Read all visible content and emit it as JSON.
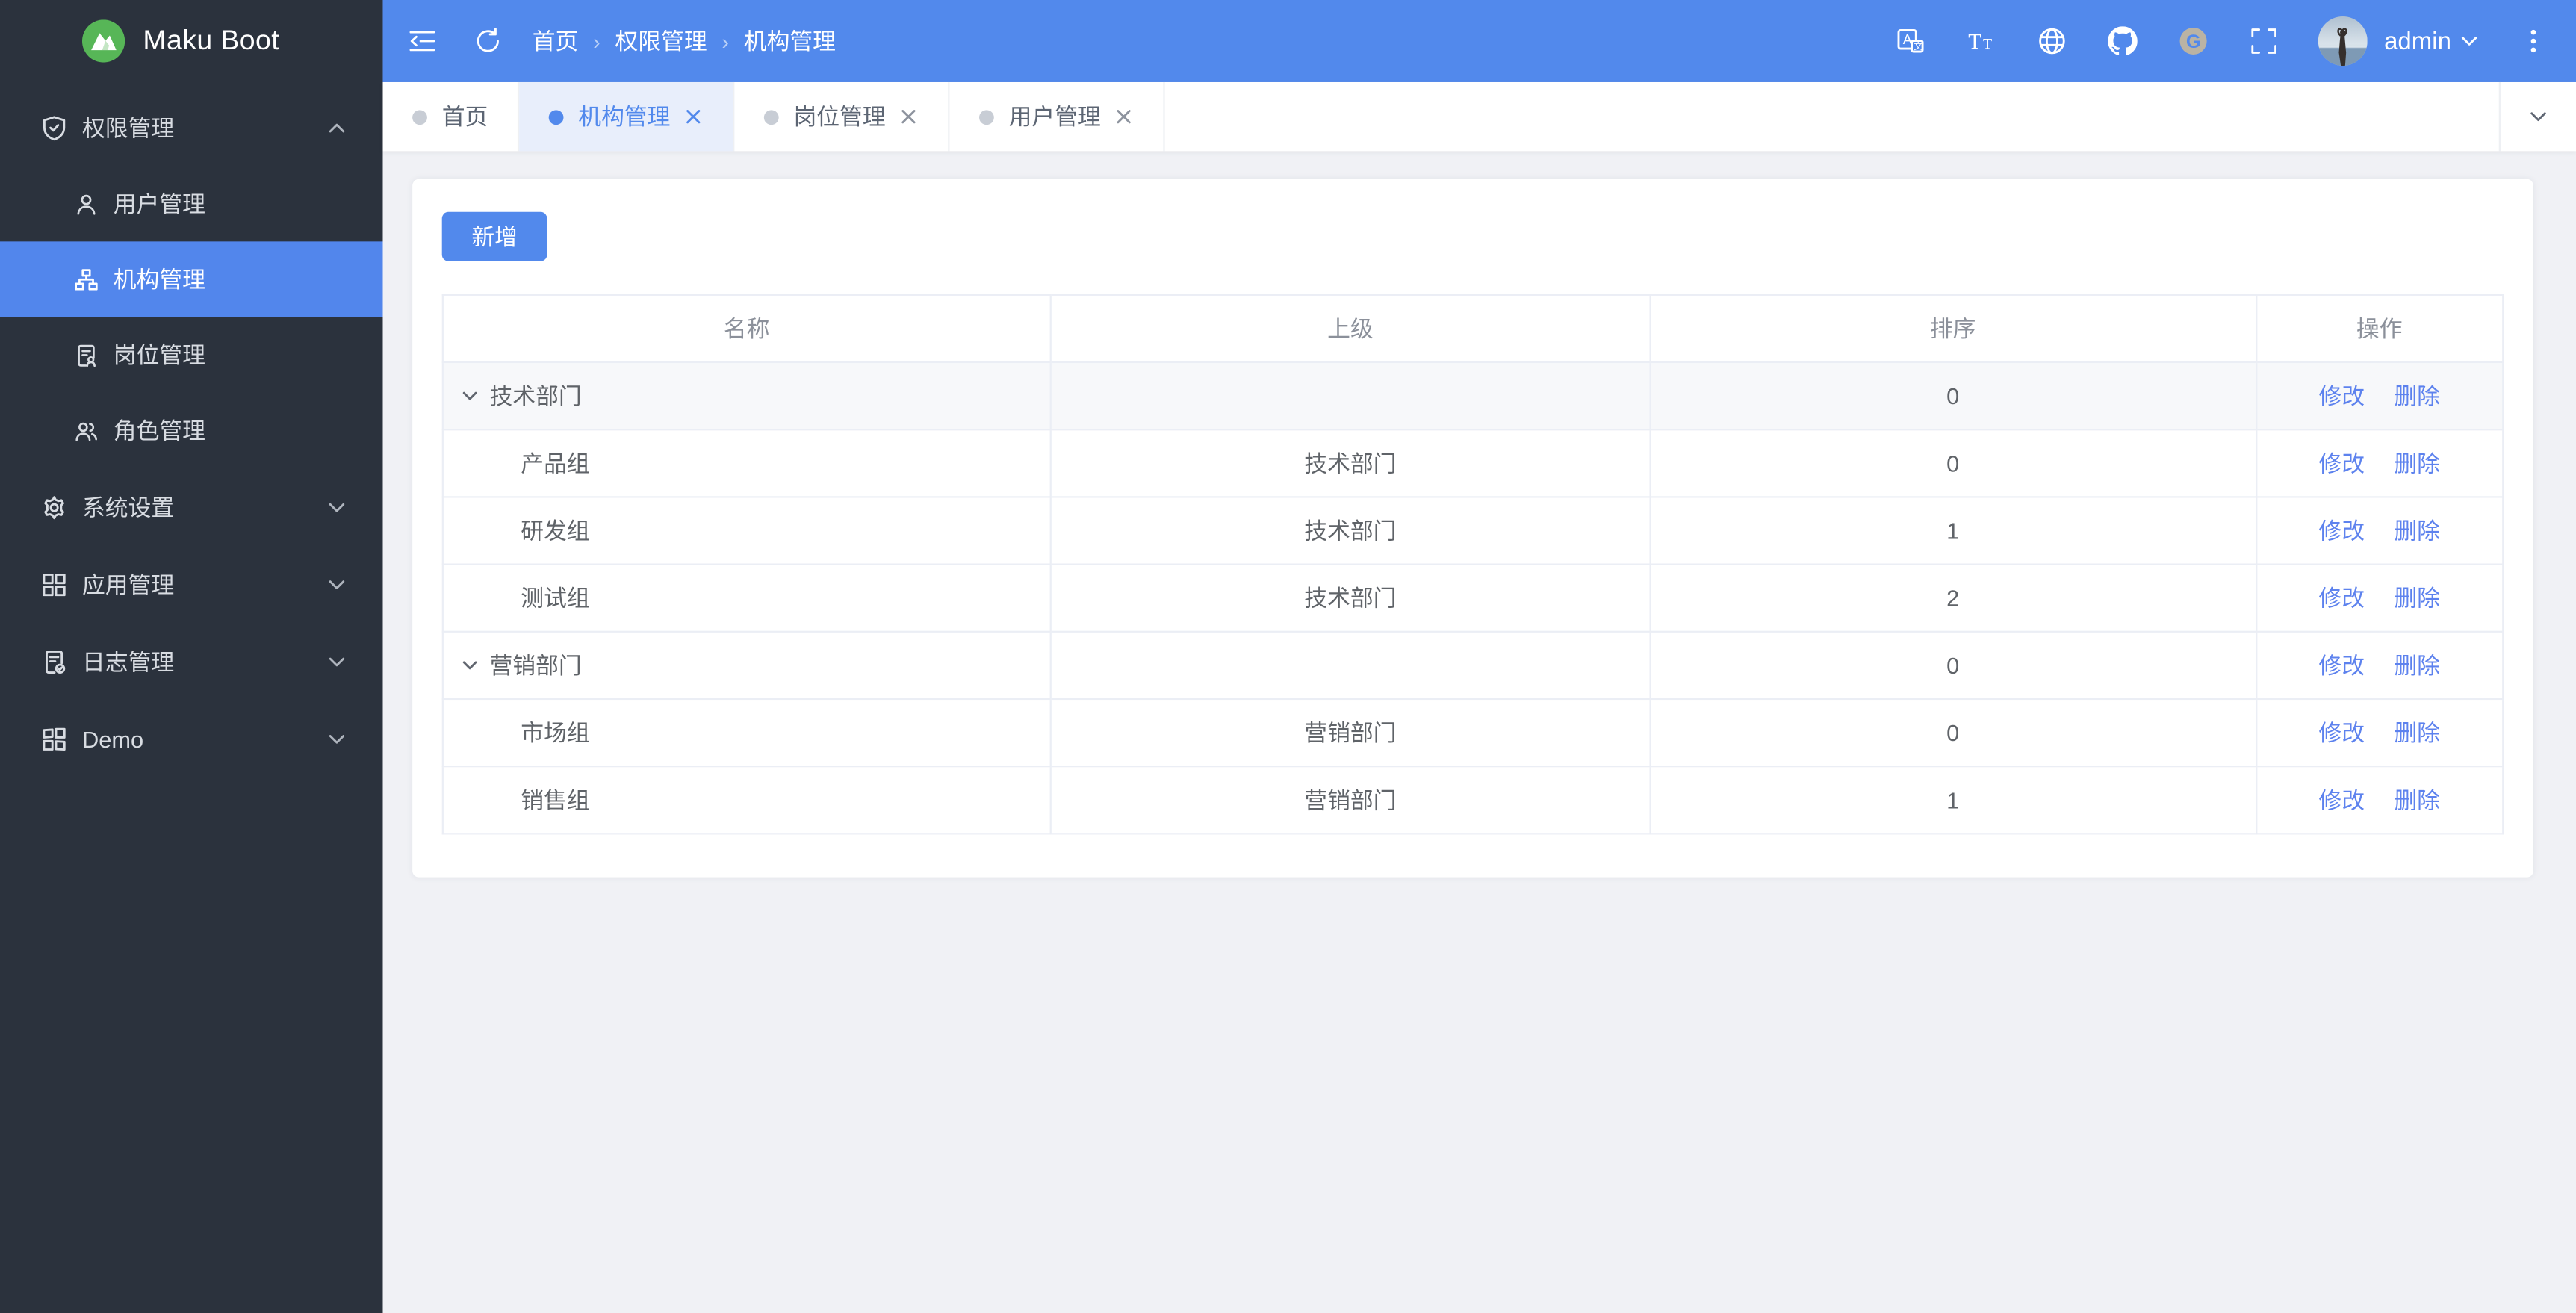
{
  "app": {
    "logo_text": "Maku Boot"
  },
  "colors": {
    "header_blue": "#5289ec",
    "sidebar_bg": "#2b323d",
    "active_item_blue": "#5286ec",
    "active_tab_bg": "#e8eefb",
    "link_blue": "#5d82ee",
    "content_bg": "#f0f1f5",
    "logo_green": "#57b657"
  },
  "sidebar": {
    "sections": [
      {
        "label": "权限管理",
        "icon": "shield-check-icon",
        "expanded": true,
        "children": [
          {
            "label": "用户管理",
            "icon": "user-icon",
            "active": false
          },
          {
            "label": "机构管理",
            "icon": "org-icon",
            "active": true
          },
          {
            "label": "岗位管理",
            "icon": "post-icon",
            "active": false
          },
          {
            "label": "角色管理",
            "icon": "roles-icon",
            "active": false
          }
        ]
      },
      {
        "label": "系统设置",
        "icon": "gear-icon",
        "expanded": false
      },
      {
        "label": "应用管理",
        "icon": "apps-icon",
        "expanded": false
      },
      {
        "label": "日志管理",
        "icon": "log-icon",
        "expanded": false
      },
      {
        "label": "Demo",
        "icon": "demo-icon",
        "expanded": false
      }
    ]
  },
  "header": {
    "breadcrumb": [
      "首页",
      "权限管理",
      "机构管理"
    ],
    "username": "admin",
    "right_icons": [
      "translate-icon",
      "font-size-icon",
      "globe-icon",
      "github-icon",
      "gitee-icon",
      "fullscreen-icon"
    ],
    "gitee_letter": "G"
  },
  "tabs": {
    "items": [
      {
        "label": "首页",
        "closable": false,
        "active": false
      },
      {
        "label": "机构管理",
        "closable": true,
        "active": true
      },
      {
        "label": "岗位管理",
        "closable": true,
        "active": false
      },
      {
        "label": "用户管理",
        "closable": true,
        "active": false
      }
    ]
  },
  "main": {
    "add_button_label": "新增",
    "table": {
      "columns": [
        "名称",
        "上级",
        "排序",
        "操作"
      ],
      "edit_label": "修改",
      "delete_label": "删除",
      "rows": [
        {
          "name": "技术部门",
          "parent": "",
          "sort": "0",
          "level": 0,
          "expandable": true,
          "highlighted": true
        },
        {
          "name": "产品组",
          "parent": "技术部门",
          "sort": "0",
          "level": 1,
          "expandable": false,
          "highlighted": false
        },
        {
          "name": "研发组",
          "parent": "技术部门",
          "sort": "1",
          "level": 1,
          "expandable": false,
          "highlighted": false
        },
        {
          "name": "测试组",
          "parent": "技术部门",
          "sort": "2",
          "level": 1,
          "expandable": false,
          "highlighted": false
        },
        {
          "name": "营销部门",
          "parent": "",
          "sort": "0",
          "level": 0,
          "expandable": true,
          "highlighted": false
        },
        {
          "name": "市场组",
          "parent": "营销部门",
          "sort": "0",
          "level": 1,
          "expandable": false,
          "highlighted": false
        },
        {
          "name": "销售组",
          "parent": "营销部门",
          "sort": "1",
          "level": 1,
          "expandable": false,
          "highlighted": false
        }
      ]
    }
  }
}
